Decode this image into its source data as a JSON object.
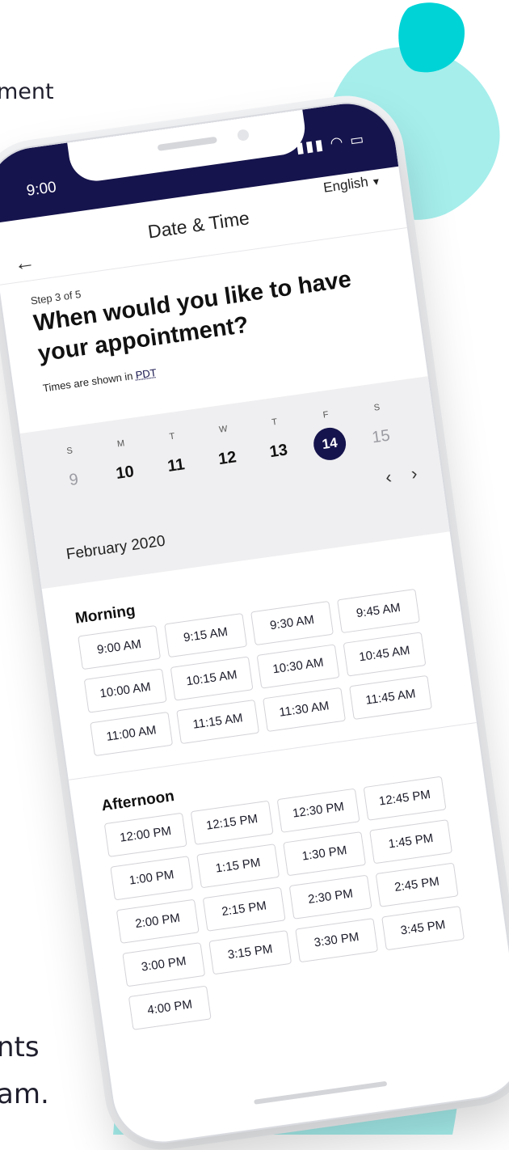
{
  "page": {
    "top_fragment": "ment",
    "bottom_fragment_1": "nts",
    "bottom_fragment_2": "am."
  },
  "colors": {
    "accent_teal": "#9ceceb",
    "accent_teal_dark": "#00d3d6",
    "brand_navy": "#16144d"
  },
  "status_bar": {
    "time": "9:00",
    "signal_icons": "signal-wifi-battery-icons"
  },
  "header": {
    "title": "Date & Time",
    "language": "English",
    "back_icon": "arrow-left-icon"
  },
  "intro": {
    "step": "Step 3 of 5",
    "question": "When would you like to have your appointment?",
    "timezone_prefix": "Times are shown in ",
    "timezone": "PDT"
  },
  "calendar": {
    "days": [
      {
        "dow": "S",
        "num": "9",
        "state": "muted"
      },
      {
        "dow": "M",
        "num": "10",
        "state": "normal"
      },
      {
        "dow": "T",
        "num": "11",
        "state": "normal"
      },
      {
        "dow": "W",
        "num": "12",
        "state": "normal"
      },
      {
        "dow": "T",
        "num": "13",
        "state": "normal"
      },
      {
        "dow": "F",
        "num": "14",
        "state": "selected"
      },
      {
        "dow": "S",
        "num": "15",
        "state": "muted"
      }
    ],
    "month": "February 2020"
  },
  "morning": {
    "title": "Morning",
    "slots": [
      "9:00 AM",
      "9:15 AM",
      "9:30 AM",
      "9:45 AM",
      "10:00 AM",
      "10:15 AM",
      "10:30 AM",
      "10:45 AM",
      "11:00 AM",
      "11:15 AM",
      "11:30 AM",
      "11:45 AM"
    ]
  },
  "afternoon": {
    "title": "Afternoon",
    "slots": [
      "12:00 PM",
      "12:15 PM",
      "12:30 PM",
      "12:45 PM",
      "1:00 PM",
      "1:15 PM",
      "1:30 PM",
      "1:45 PM",
      "2:00 PM",
      "2:15 PM",
      "2:30 PM",
      "2:45 PM",
      "3:00 PM",
      "3:15 PM",
      "3:30 PM",
      "3:45 PM",
      "4:00 PM"
    ]
  }
}
